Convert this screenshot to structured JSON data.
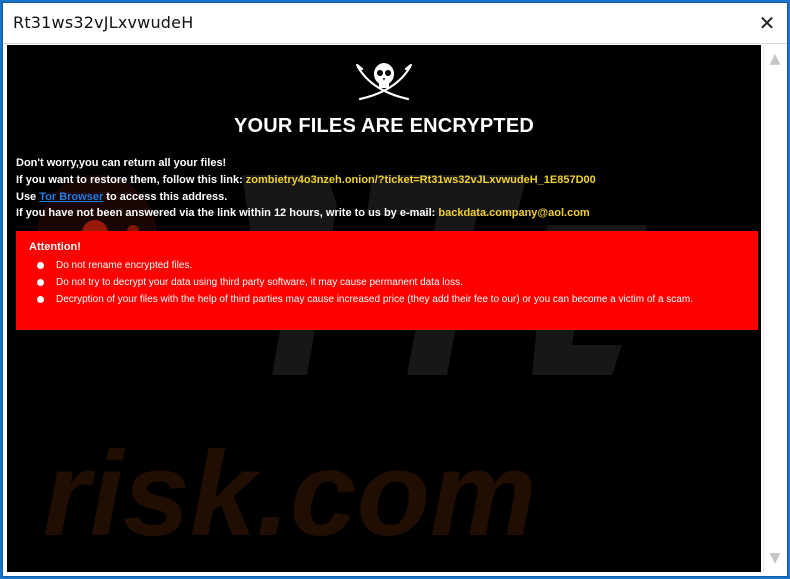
{
  "window": {
    "title": "Rt31ws32vJLxvwudeH",
    "close_label": "✕"
  },
  "scrollbar": {
    "up_icon": "▲",
    "down_icon": "▼"
  },
  "note": {
    "icon": "skull-crossed-swords-icon",
    "headline": "YOUR FILES ARE ENCRYPTED",
    "line1": "Don't worry,you can return all your files!",
    "line2_prefix": "If you want to restore them, follow this link: ",
    "line2_link": "zombietry4o3nzeh.onion/?ticket=Rt31ws32vJLxvwudeH_1E857D00",
    "line3_prefix": "Use ",
    "line3_link": "Tor Browser",
    "line3_suffix": " to access this address.",
    "line4_prefix": "If you have not been answered via the link within 12 hours, write to us by e-mail: ",
    "line4_email": "backdata.company@aol.com"
  },
  "attention": {
    "title": "Attention!",
    "items": [
      "Do not rename encrypted files.",
      "Do not try to decrypt your data using third party software, it may cause permanent data loss.",
      "Decryption of your files with the help of third parties may cause increased price (they add their fee to our) or you can become a victim of a scam."
    ]
  },
  "watermark_text": "risk.com",
  "colors": {
    "background": "#000000",
    "headline": "#ffffff",
    "highlight": "#f2d030",
    "alert": "#fe0000",
    "link": "#1e7ee8"
  }
}
